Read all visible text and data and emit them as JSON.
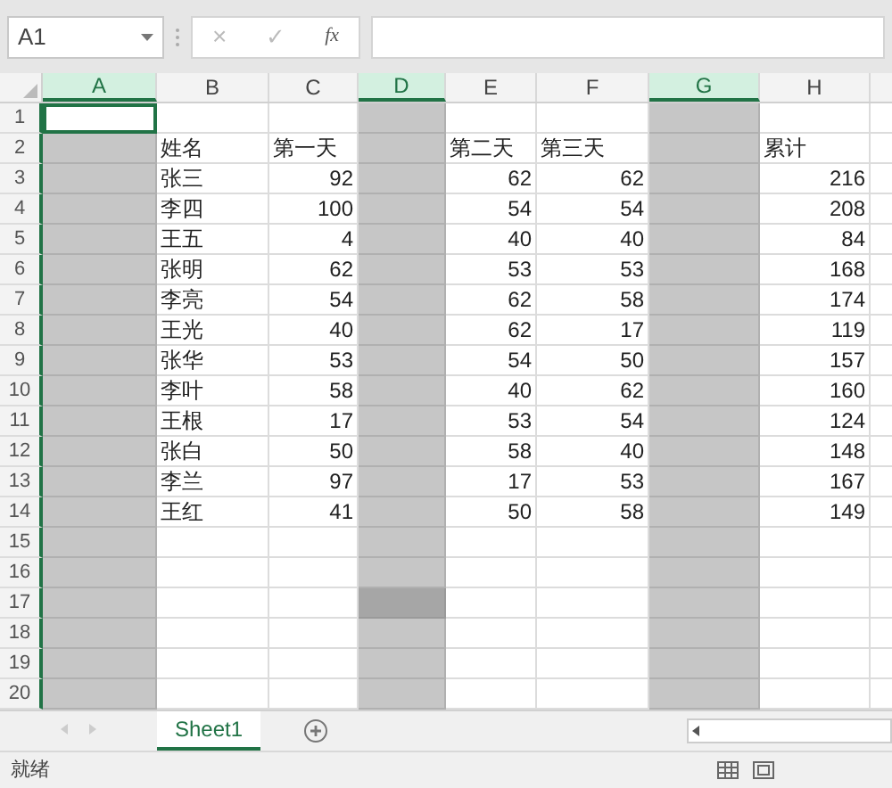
{
  "name_box": "A1",
  "formula_bar": {
    "cancel": "×",
    "enter": "✓",
    "function": "fx"
  },
  "columns": [
    {
      "label": "A",
      "selected": true
    },
    {
      "label": "B",
      "selected": false
    },
    {
      "label": "C",
      "selected": false
    },
    {
      "label": "D",
      "selected": true
    },
    {
      "label": "E",
      "selected": false
    },
    {
      "label": "F",
      "selected": false
    },
    {
      "label": "G",
      "selected": true
    },
    {
      "label": "H",
      "selected": false
    }
  ],
  "rows": [
    {
      "number": "1",
      "active": true
    },
    {
      "number": "2",
      "cells": {
        "B": "姓名",
        "C": "第一天",
        "E": "第二天",
        "F": "第三天",
        "H": "累计"
      }
    },
    {
      "number": "3",
      "cells": {
        "B": "张三",
        "C": "92",
        "E": "62",
        "F": "62",
        "H": "216"
      }
    },
    {
      "number": "4",
      "cells": {
        "B": "李四",
        "C": "100",
        "E": "54",
        "F": "54",
        "H": "208"
      }
    },
    {
      "number": "5",
      "cells": {
        "B": "王五",
        "C": "4",
        "E": "40",
        "F": "40",
        "H": "84"
      }
    },
    {
      "number": "6",
      "cells": {
        "B": "张明",
        "C": "62",
        "E": "53",
        "F": "53",
        "H": "168"
      }
    },
    {
      "number": "7",
      "cells": {
        "B": "李亮",
        "C": "54",
        "E": "62",
        "F": "58",
        "H": "174"
      }
    },
    {
      "number": "8",
      "cells": {
        "B": "王光",
        "C": "40",
        "E": "62",
        "F": "17",
        "H": "119"
      }
    },
    {
      "number": "9",
      "cells": {
        "B": "张华",
        "C": "53",
        "E": "54",
        "F": "50",
        "H": "157"
      }
    },
    {
      "number": "10",
      "cells": {
        "B": "李叶",
        "C": "58",
        "E": "40",
        "F": "62",
        "H": "160"
      }
    },
    {
      "number": "11",
      "cells": {
        "B": "王根",
        "C": "17",
        "E": "53",
        "F": "54",
        "H": "124"
      }
    },
    {
      "number": "12",
      "cells": {
        "B": "张白",
        "C": "50",
        "E": "58",
        "F": "40",
        "H": "148"
      }
    },
    {
      "number": "13",
      "cells": {
        "B": "李兰",
        "C": "97",
        "E": "17",
        "F": "53",
        "H": "167"
      }
    },
    {
      "number": "14",
      "cells": {
        "B": "王红",
        "C": "41",
        "E": "50",
        "F": "58",
        "H": "149"
      }
    },
    {
      "number": "15"
    },
    {
      "number": "16"
    },
    {
      "number": "17",
      "dark_cell": true
    },
    {
      "number": "18"
    },
    {
      "number": "19"
    },
    {
      "number": "20"
    }
  ],
  "sheet_tabs": [
    {
      "label": "Sheet1",
      "selected": true
    }
  ],
  "status_bar": {
    "text": "就绪"
  }
}
